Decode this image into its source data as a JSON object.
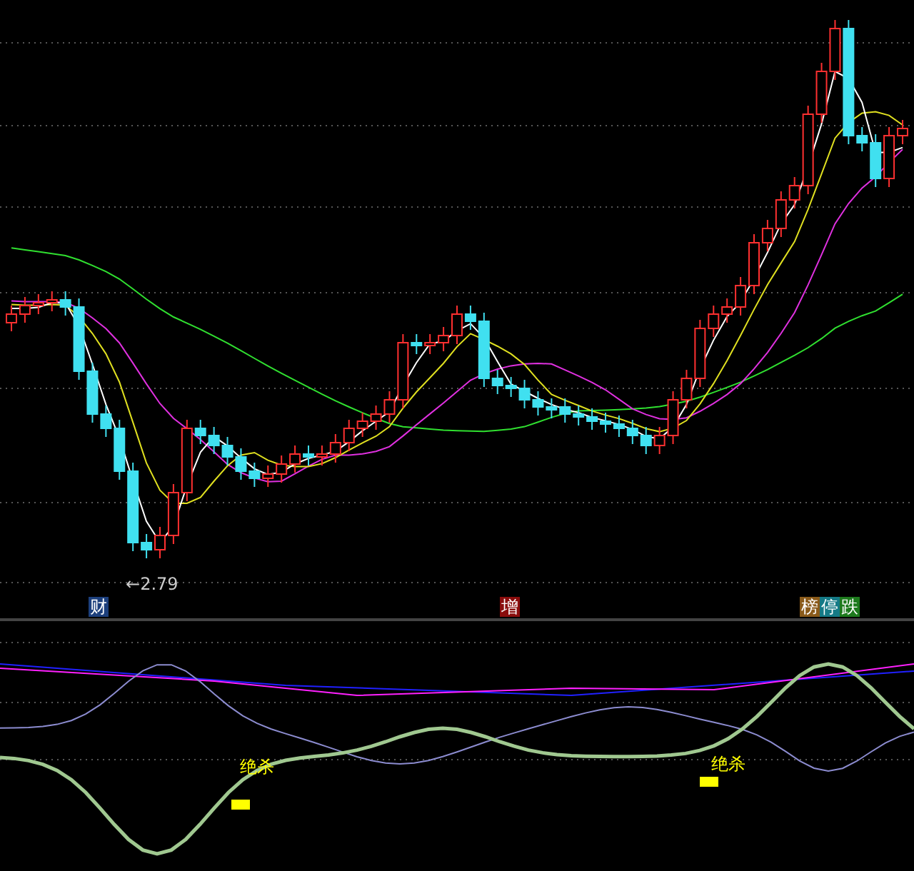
{
  "price_panel": {
    "low_marker": {
      "arrow": "←",
      "value": "2.79"
    },
    "tag_groups": [
      [
        {
          "text": "财",
          "color": "#1c3f7c"
        }
      ],
      [
        {
          "text": "增",
          "color": "#8a0c0c"
        }
      ],
      [
        {
          "text": "榜",
          "color": "#8a5a1a"
        },
        {
          "text": "停",
          "color": "#157a86"
        },
        {
          "text": "跌",
          "color": "#1d7a1d"
        }
      ]
    ]
  },
  "indicator_panel": {
    "signals": [
      {
        "text": "绝杀"
      },
      {
        "text": "绝杀"
      }
    ]
  }
}
